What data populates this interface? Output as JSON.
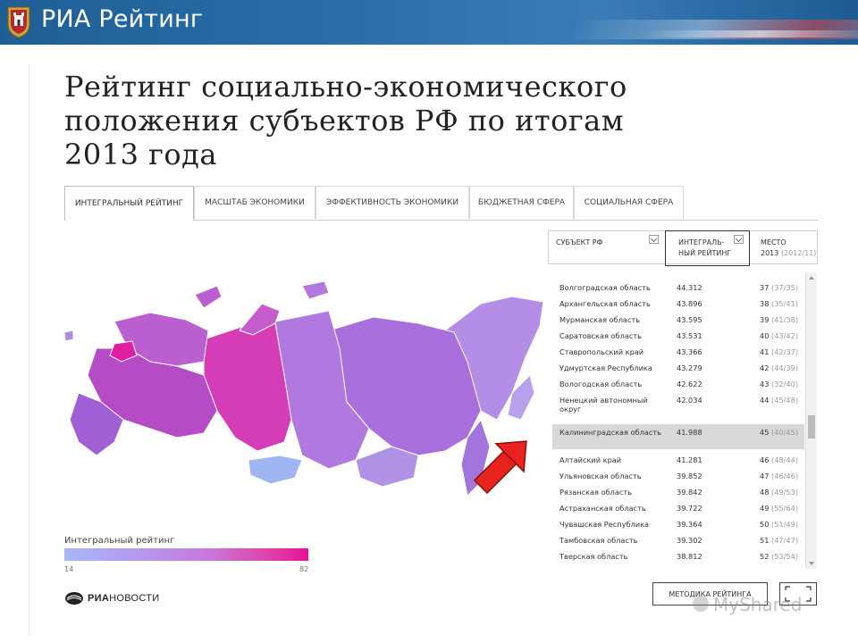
{
  "header": {
    "brand": "РИА Рейтинг"
  },
  "title": "Рейтинг социально-экономического положения субъектов РФ по итогам 2013 года",
  "tabs": [
    {
      "label": "ИНТЕГРАЛЬНЫЙ РЕЙТИНГ",
      "active": true
    },
    {
      "label": "МАСШТАБ ЭКОНОМИКИ",
      "active": false
    },
    {
      "label": "ЭФФЕКТИВНОСТЬ ЭКОНОМИКИ",
      "active": false
    },
    {
      "label": "БЮДЖЕТНАЯ СФЕРА",
      "active": false
    },
    {
      "label": "СОЦИАЛЬНАЯ СФЕРА",
      "active": false
    }
  ],
  "table": {
    "columns": {
      "subject": "СУБЪЕКТ РФ",
      "rating_line1": "ИНТЕГРАЛЬ-",
      "rating_line2": "НЫЙ РЕЙТИНГ",
      "place": "МЕСТО",
      "place_year": "2013",
      "place_prev": "(2012/11)"
    },
    "rows": [
      {
        "name": "Волгоградская область",
        "value": "44.312",
        "place": "37",
        "prev": "(37/35)"
      },
      {
        "name": "Архангельская область",
        "value": "43.896",
        "place": "38",
        "prev": "(35/41)"
      },
      {
        "name": "Мурманская область",
        "value": "43.595",
        "place": "39",
        "prev": "(41/38)"
      },
      {
        "name": "Саратовская область",
        "value": "43.531",
        "place": "40",
        "prev": "(43/42)"
      },
      {
        "name": "Ставропольский край",
        "value": "43.366",
        "place": "41",
        "prev": "(42/37)"
      },
      {
        "name": "Удмуртская Республика",
        "value": "43.279",
        "place": "42",
        "prev": "(44/39)"
      },
      {
        "name": "Вологодская область",
        "value": "42.622",
        "place": "43",
        "prev": "(32/40)"
      },
      {
        "name": "Ненецкий автономный округ",
        "value": "42.034",
        "place": "44",
        "prev": "(45/48)"
      },
      {
        "name": "Калининградская область",
        "value": "41.988",
        "place": "45",
        "prev": "(40/45)",
        "highlight": true
      },
      {
        "name": "Алтайский край",
        "value": "41.281",
        "place": "46",
        "prev": "(48/44)"
      },
      {
        "name": "Ульяновская область",
        "value": "39.852",
        "place": "47",
        "prev": "(46/46)"
      },
      {
        "name": "Рязанская область",
        "value": "39.842",
        "place": "48",
        "prev": "(49/53)"
      },
      {
        "name": "Астраханская область",
        "value": "39.722",
        "place": "49",
        "prev": "(55/64)"
      },
      {
        "name": "Чувашская Республика",
        "value": "39.364",
        "place": "50",
        "prev": "(51/49)"
      },
      {
        "name": "Тамбовская область",
        "value": "39.302",
        "place": "51",
        "prev": "(47/47)"
      },
      {
        "name": "Тверская область",
        "value": "38.812",
        "place": "52",
        "prev": "(53/54)"
      }
    ]
  },
  "legend": {
    "title": "Интегральный рейтинг",
    "min": "14",
    "max": "82"
  },
  "footer": {
    "logo_bold": "РИА",
    "logo_light": "НОВОСТИ",
    "method_button": "МЕТОДИКА РЕЙТИНГА",
    "watermark": "MyShared"
  },
  "colors": {
    "banner": "#2a6ea8",
    "scale_low": "#a9b8f4",
    "scale_high": "#e6139a",
    "highlight_row": "#d9d9d9",
    "arrow": "#e8231f"
  }
}
